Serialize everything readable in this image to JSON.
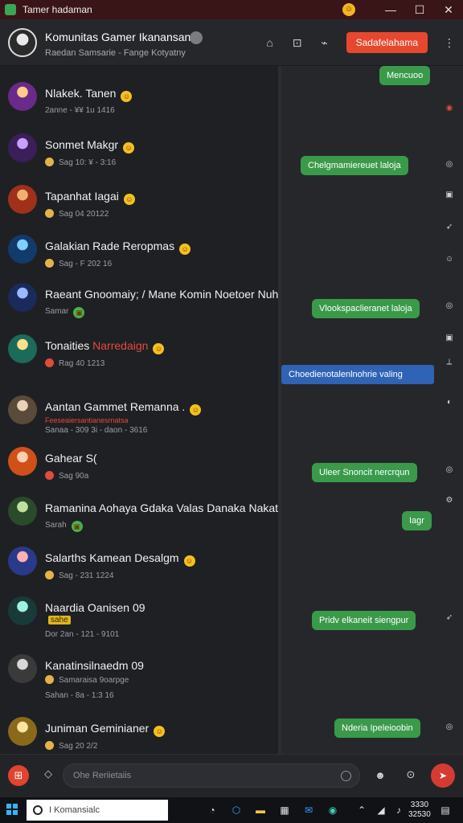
{
  "window": {
    "title": "Tamer hadaman"
  },
  "header": {
    "name": "Komunitas Gamer Ikanansan",
    "subtitle": "Raedan Samsarie - Fange Kotyatny",
    "cta": "Sadafelahama"
  },
  "contacts": [
    {
      "name": "Nlakek. Tanen",
      "meta": "2anne - ¥¥ 1u 1416",
      "flag": ""
    },
    {
      "name": "Sonmet Makgr",
      "meta": "Sag 10: ¥ - 3:16",
      "flag": ""
    },
    {
      "name": "Tapanhat Iagai",
      "meta": "Sag 04 20122",
      "flag": ""
    },
    {
      "name": "Galakian Rade Reropmas",
      "meta": "Sag - F 202 16",
      "flag": ""
    },
    {
      "name": "Raeant Gnoomaiy; / Mane Komin Noetoer Nuhat",
      "meta": "Samar",
      "flag": ""
    },
    {
      "name": "Tonaities",
      "highlight": "Narredaign",
      "meta": "Rag 40 1213",
      "flag": ""
    },
    {
      "name": "Aantan Gammet Remanna .",
      "meta": "Sanaa - 309 3i - daon - 3616",
      "flag": ""
    },
    {
      "name": "Gahear S(",
      "meta": "Sag 90a",
      "flag": ""
    },
    {
      "name": "Ramanina Aohaya Gdaka Valas Danaka Nakat",
      "meta": "Sarah",
      "flag": ""
    },
    {
      "name": "Salarths Kamean Desalgm",
      "meta": "Sag - 231 1224",
      "flag": ""
    },
    {
      "name": "Naardia Oanisen 09",
      "meta": "Dor 2an - 121 - 9101",
      "tag": "sahe",
      "flag": ""
    },
    {
      "name": "Kanatinsilnaedm 09",
      "meta2": "Samaraisa 9oarpge",
      "meta": "Sahan - 8a - 1:3 16",
      "flag": ""
    },
    {
      "name": "Juniman Geminianer",
      "meta": "Sag 20 2/2",
      "flag": ""
    }
  ],
  "red_subtext": "Feeseaiersantianesrnatsa",
  "chat": {
    "bubbles": [
      {
        "text": "Mencuoo",
        "color": "green"
      },
      {
        "text": "Chelgmamiereuet laloja",
        "color": "green"
      },
      {
        "text": "Vlookspaclieranet laloja",
        "color": "green"
      },
      {
        "text": "Choedienotalenlnohrie valing",
        "color": "blue"
      },
      {
        "text": "Uleer Snoncit nercrqun",
        "color": "green"
      },
      {
        "text": "Iagr",
        "color": "green"
      },
      {
        "text": "Pridv elkaneit siengpur",
        "color": "green"
      },
      {
        "text": "Nderia Ipeleioobin",
        "color": "green"
      }
    ]
  },
  "composer": {
    "placeholder": "Ohe Reriietaiis"
  },
  "taskbar": {
    "search": "I Komansialc",
    "time": "3330",
    "date": "32530"
  },
  "colors": {
    "accent": "#e8472f",
    "bubble_green": "#3a9a4a",
    "bubble_blue": "#2e63b5"
  }
}
